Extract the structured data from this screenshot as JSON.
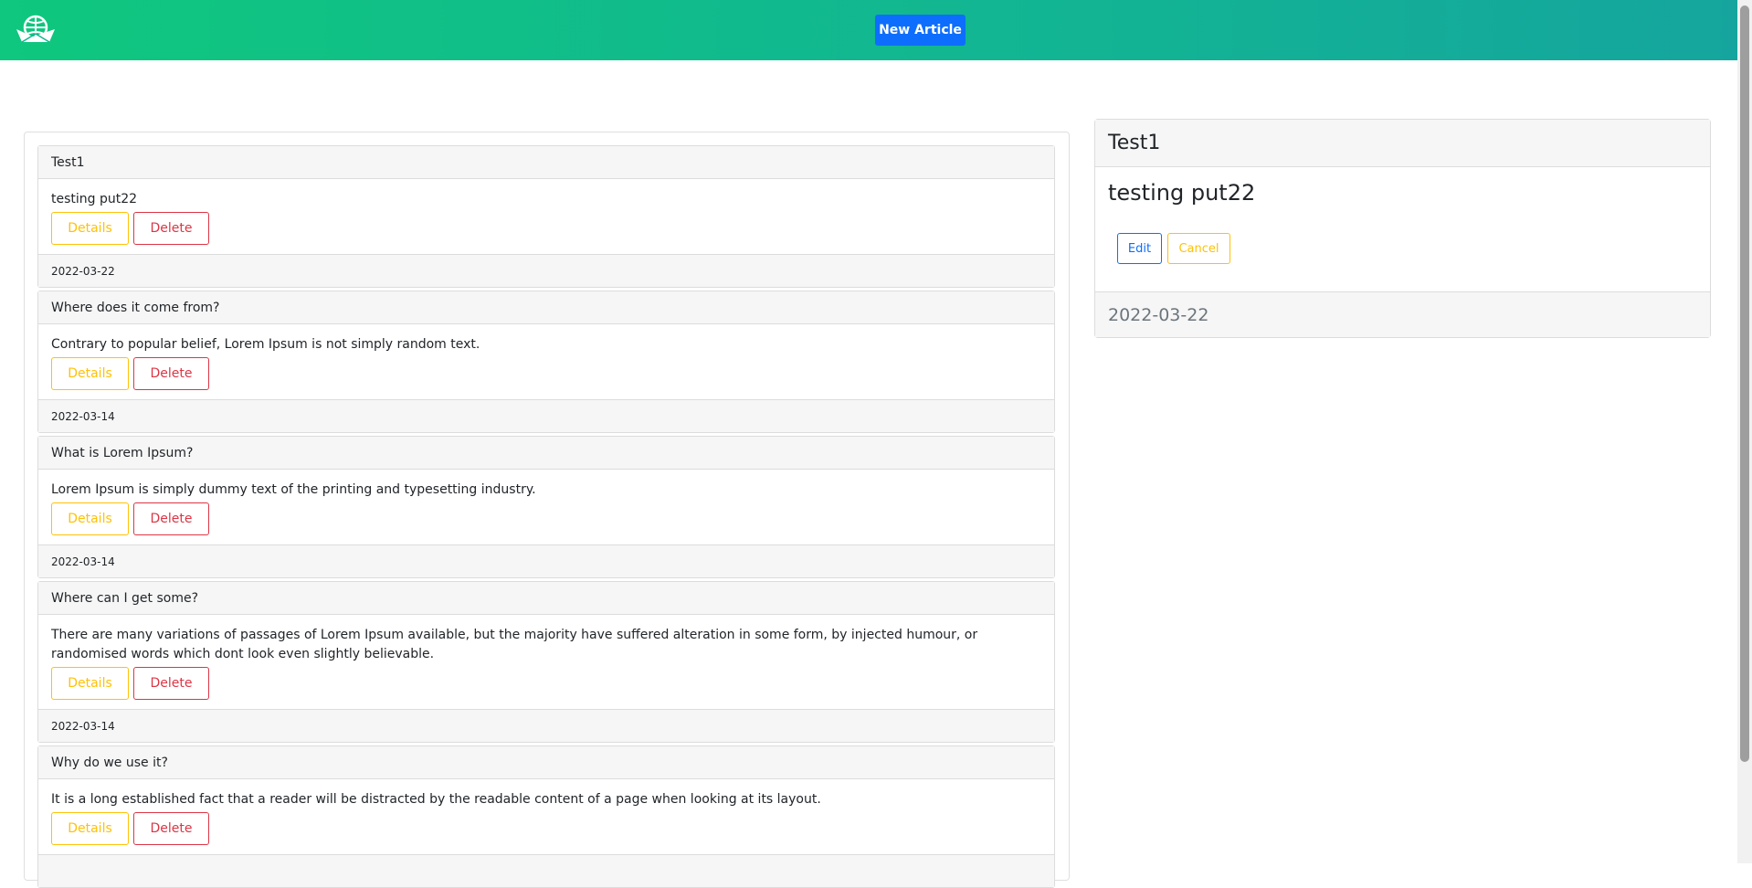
{
  "header": {
    "logo_icon": "globe-envelope-logo-icon",
    "new_article_label": "New Article"
  },
  "articles": [
    {
      "title": "Test1",
      "body": "testing put22",
      "date": "2022-03-22",
      "details_label": "Details",
      "delete_label": "Delete"
    },
    {
      "title": "Where does it come from?",
      "body": "Contrary to popular belief, Lorem Ipsum is not simply random text.",
      "date": "2022-03-14",
      "details_label": "Details",
      "delete_label": "Delete"
    },
    {
      "title": "What is Lorem Ipsum?",
      "body": "Lorem Ipsum is simply dummy text of the printing and typesetting industry.",
      "date": "2022-03-14",
      "details_label": "Details",
      "delete_label": "Delete"
    },
    {
      "title": "Where can I get some?",
      "body": "There are many variations of passages of Lorem Ipsum available, but the majority have suffered alteration in some form, by injected humour, or randomised words which dont look even slightly believable.",
      "date": "2022-03-14",
      "details_label": "Details",
      "delete_label": "Delete"
    },
    {
      "title": "Why do we use it?",
      "body": "It is a long established fact that a reader will be distracted by the readable content of a page when looking at its layout.",
      "date": "",
      "details_label": "Details",
      "delete_label": "Delete"
    }
  ],
  "detail": {
    "title": "Test1",
    "body": "testing put22",
    "edit_label": "Edit",
    "cancel_label": "Cancel",
    "date": "2022-03-22"
  },
  "colors": {
    "brand_green": "#0fc77e",
    "primary": "#0d6efd",
    "warning": "#ffc107",
    "danger": "#dc3545"
  }
}
